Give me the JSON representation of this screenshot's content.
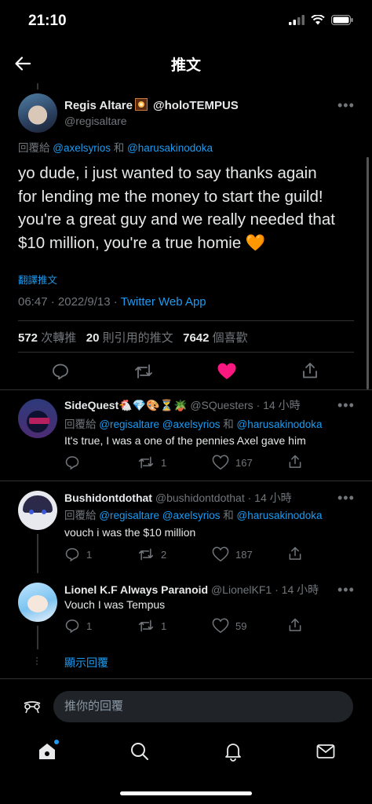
{
  "status": {
    "time": "21:10"
  },
  "header": {
    "title": "推文"
  },
  "main_tweet": {
    "display_name": "Regis Altare",
    "handle_inline": "@holoTEMPUS",
    "username": "@regisaltare",
    "reply_prefix": "回覆給",
    "reply_user1": "@axelsyrios",
    "reply_and": "和",
    "reply_user2": "@harusakinodoka",
    "text_line1": "yo dude, i just wanted to say thanks again",
    "text_line2": "for lending me the money to start the guild!",
    "text_line3": "you're a great guy and we really needed that",
    "text_line4": "$10 million, you're a true homie 🧡",
    "translate": "翻譯推文",
    "time": "06:47",
    "dot": "·",
    "date": "2022/9/13",
    "source": "Twitter Web App",
    "retweets": "572",
    "retweets_label": "次轉推",
    "quotes": "20",
    "quotes_label": "則引用的推文",
    "likes": "7642",
    "likes_label": "個喜歡"
  },
  "replies": [
    {
      "name": "SideQuest",
      "emojis": "🐔💎🎨⏳🪴",
      "handle": "@SQuesters",
      "time": "· 14 小時",
      "reply_prefix": "回覆給",
      "reply_users": "@regisaltare @axelsyrios",
      "reply_and": "和",
      "reply_last": "@harusakinodoka",
      "text": "It's true, I was a one of the pennies Axel gave him",
      "replies": "",
      "retweets": "1",
      "likes": "167"
    },
    {
      "name": "Bushidontdothat",
      "handle": "@bushidontdothat",
      "time": "· 14 小時",
      "reply_prefix": "回覆給",
      "reply_users": "@regisaltare @axelsyrios",
      "reply_and": "和",
      "reply_last": "@harusakinodoka",
      "text": "vouch i was the $10 million",
      "replies": "1",
      "retweets": "2",
      "likes": "187"
    },
    {
      "name": "Lionel K.F Always Paranoid",
      "handle": "@LionelKF1",
      "time": "· 14 小時",
      "text": "Vouch I was Tempus",
      "replies": "1",
      "retweets": "1",
      "likes": "59"
    }
  ],
  "show_replies": "顯示回覆",
  "compose": {
    "placeholder": "推你的回覆"
  },
  "colors": {
    "accent": "#1d9bf0",
    "like": "#f91880",
    "background": "#000000",
    "muted": "#71767b"
  }
}
